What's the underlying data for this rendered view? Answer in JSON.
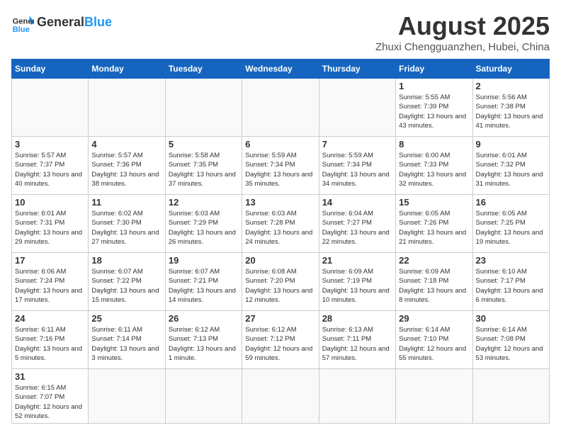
{
  "header": {
    "logo_general": "General",
    "logo_blue": "Blue",
    "title": "August 2025",
    "subtitle": "Zhuxi Chengguanzhen, Hubei, China"
  },
  "weekdays": [
    "Sunday",
    "Monday",
    "Tuesday",
    "Wednesday",
    "Thursday",
    "Friday",
    "Saturday"
  ],
  "weeks": [
    [
      {
        "day": "",
        "info": ""
      },
      {
        "day": "",
        "info": ""
      },
      {
        "day": "",
        "info": ""
      },
      {
        "day": "",
        "info": ""
      },
      {
        "day": "",
        "info": ""
      },
      {
        "day": "1",
        "info": "Sunrise: 5:55 AM\nSunset: 7:39 PM\nDaylight: 13 hours and 43 minutes."
      },
      {
        "day": "2",
        "info": "Sunrise: 5:56 AM\nSunset: 7:38 PM\nDaylight: 13 hours and 41 minutes."
      }
    ],
    [
      {
        "day": "3",
        "info": "Sunrise: 5:57 AM\nSunset: 7:37 PM\nDaylight: 13 hours and 40 minutes."
      },
      {
        "day": "4",
        "info": "Sunrise: 5:57 AM\nSunset: 7:36 PM\nDaylight: 13 hours and 38 minutes."
      },
      {
        "day": "5",
        "info": "Sunrise: 5:58 AM\nSunset: 7:35 PM\nDaylight: 13 hours and 37 minutes."
      },
      {
        "day": "6",
        "info": "Sunrise: 5:59 AM\nSunset: 7:34 PM\nDaylight: 13 hours and 35 minutes."
      },
      {
        "day": "7",
        "info": "Sunrise: 5:59 AM\nSunset: 7:34 PM\nDaylight: 13 hours and 34 minutes."
      },
      {
        "day": "8",
        "info": "Sunrise: 6:00 AM\nSunset: 7:33 PM\nDaylight: 13 hours and 32 minutes."
      },
      {
        "day": "9",
        "info": "Sunrise: 6:01 AM\nSunset: 7:32 PM\nDaylight: 13 hours and 31 minutes."
      }
    ],
    [
      {
        "day": "10",
        "info": "Sunrise: 6:01 AM\nSunset: 7:31 PM\nDaylight: 13 hours and 29 minutes."
      },
      {
        "day": "11",
        "info": "Sunrise: 6:02 AM\nSunset: 7:30 PM\nDaylight: 13 hours and 27 minutes."
      },
      {
        "day": "12",
        "info": "Sunrise: 6:03 AM\nSunset: 7:29 PM\nDaylight: 13 hours and 26 minutes."
      },
      {
        "day": "13",
        "info": "Sunrise: 6:03 AM\nSunset: 7:28 PM\nDaylight: 13 hours and 24 minutes."
      },
      {
        "day": "14",
        "info": "Sunrise: 6:04 AM\nSunset: 7:27 PM\nDaylight: 13 hours and 22 minutes."
      },
      {
        "day": "15",
        "info": "Sunrise: 6:05 AM\nSunset: 7:26 PM\nDaylight: 13 hours and 21 minutes."
      },
      {
        "day": "16",
        "info": "Sunrise: 6:05 AM\nSunset: 7:25 PM\nDaylight: 13 hours and 19 minutes."
      }
    ],
    [
      {
        "day": "17",
        "info": "Sunrise: 6:06 AM\nSunset: 7:24 PM\nDaylight: 13 hours and 17 minutes."
      },
      {
        "day": "18",
        "info": "Sunrise: 6:07 AM\nSunset: 7:22 PM\nDaylight: 13 hours and 15 minutes."
      },
      {
        "day": "19",
        "info": "Sunrise: 6:07 AM\nSunset: 7:21 PM\nDaylight: 13 hours and 14 minutes."
      },
      {
        "day": "20",
        "info": "Sunrise: 6:08 AM\nSunset: 7:20 PM\nDaylight: 13 hours and 12 minutes."
      },
      {
        "day": "21",
        "info": "Sunrise: 6:09 AM\nSunset: 7:19 PM\nDaylight: 13 hours and 10 minutes."
      },
      {
        "day": "22",
        "info": "Sunrise: 6:09 AM\nSunset: 7:18 PM\nDaylight: 13 hours and 8 minutes."
      },
      {
        "day": "23",
        "info": "Sunrise: 6:10 AM\nSunset: 7:17 PM\nDaylight: 13 hours and 6 minutes."
      }
    ],
    [
      {
        "day": "24",
        "info": "Sunrise: 6:11 AM\nSunset: 7:16 PM\nDaylight: 13 hours and 5 minutes."
      },
      {
        "day": "25",
        "info": "Sunrise: 6:11 AM\nSunset: 7:14 PM\nDaylight: 13 hours and 3 minutes."
      },
      {
        "day": "26",
        "info": "Sunrise: 6:12 AM\nSunset: 7:13 PM\nDaylight: 13 hours and 1 minute."
      },
      {
        "day": "27",
        "info": "Sunrise: 6:12 AM\nSunset: 7:12 PM\nDaylight: 12 hours and 59 minutes."
      },
      {
        "day": "28",
        "info": "Sunrise: 6:13 AM\nSunset: 7:11 PM\nDaylight: 12 hours and 57 minutes."
      },
      {
        "day": "29",
        "info": "Sunrise: 6:14 AM\nSunset: 7:10 PM\nDaylight: 12 hours and 55 minutes."
      },
      {
        "day": "30",
        "info": "Sunrise: 6:14 AM\nSunset: 7:08 PM\nDaylight: 12 hours and 53 minutes."
      }
    ],
    [
      {
        "day": "31",
        "info": "Sunrise: 6:15 AM\nSunset: 7:07 PM\nDaylight: 12 hours and 52 minutes."
      },
      {
        "day": "",
        "info": ""
      },
      {
        "day": "",
        "info": ""
      },
      {
        "day": "",
        "info": ""
      },
      {
        "day": "",
        "info": ""
      },
      {
        "day": "",
        "info": ""
      },
      {
        "day": "",
        "info": ""
      }
    ]
  ]
}
